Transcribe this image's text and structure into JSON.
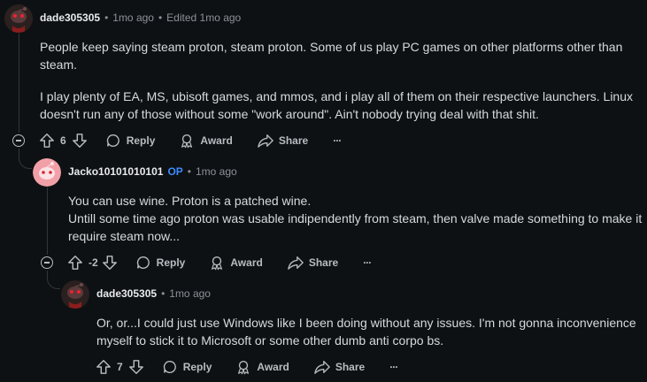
{
  "comments": [
    {
      "username": "dade305305",
      "time": "1mo ago",
      "edited": "Edited 1mo ago",
      "paragraphs": [
        "People keep saying steam proton, steam proton. Some of us play PC games on other platforms other than steam.",
        "I play plenty of EA, MS, ubisoft games, and mmos, and i play all of them on their respective launchers. Linux doesn't run any of those without some \"work around\". Ain't nobody trying deal with that shit."
      ],
      "score": "6"
    },
    {
      "username": "Jacko10101010101",
      "op_badge": "OP",
      "time": "1mo ago",
      "lines": [
        "You can use wine. Proton is a patched wine.",
        "Untill some time ago proton was usable indipendently from steam, then valve made something to make it require steam now..."
      ],
      "score": "-2"
    },
    {
      "username": "dade305305",
      "time": "1mo ago",
      "paragraphs": [
        "Or, or...I could just use Windows like I been doing without any issues. I'm not gonna inconvenience myself to stick it to Microsoft or some other dumb anti corpo bs."
      ],
      "score": "7"
    }
  ],
  "actions": {
    "reply": "Reply",
    "award": "Award",
    "share": "Share",
    "more": "···"
  },
  "separator": "•",
  "colors": {
    "background": "#0e1113",
    "op": "#3d8bff",
    "avatar_pink": "#f2a0a8",
    "avatar_dark": "#3a2a2a"
  }
}
